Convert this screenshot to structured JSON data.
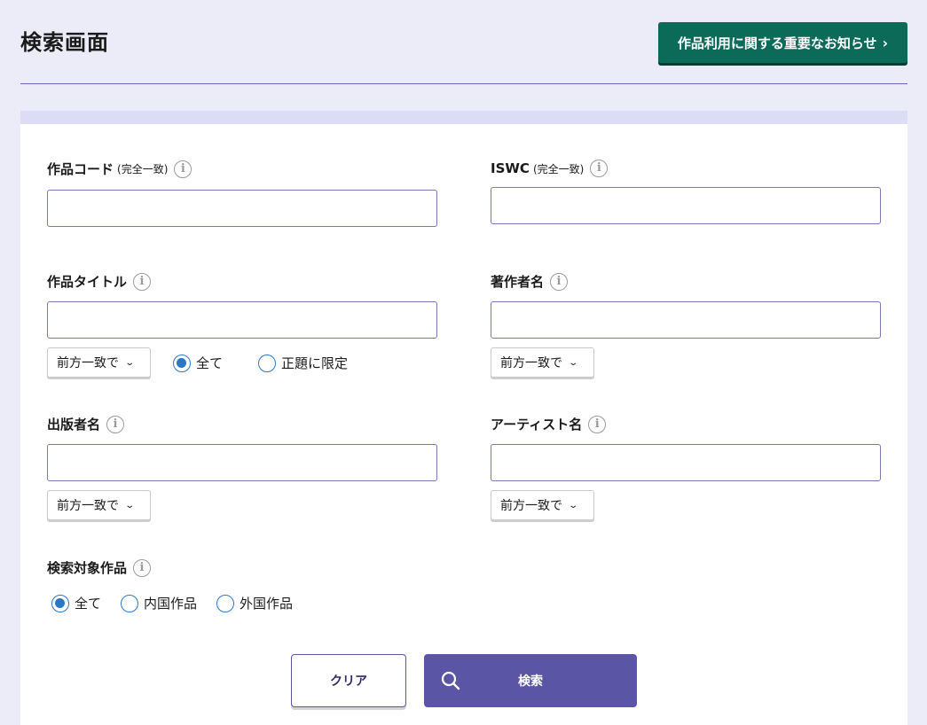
{
  "header": {
    "title": "検索画面",
    "notice_label": "作品利用に関する重要なお知らせ",
    "notice_chevron": "›"
  },
  "fields": {
    "work_code": {
      "label": "作品コード",
      "note": "(完全一致)",
      "value": ""
    },
    "iswc": {
      "label": "ISWC",
      "note": "(完全一致)",
      "value": ""
    },
    "work_title": {
      "label": "作品タイトル",
      "value": "",
      "match": "前方一致で",
      "scope_options": [
        "全て",
        "正題に限定"
      ],
      "scope_selected": "全て"
    },
    "author": {
      "label": "著作者名",
      "value": "",
      "match": "前方一致で"
    },
    "publisher": {
      "label": "出版者名",
      "value": "",
      "match": "前方一致で"
    },
    "artist": {
      "label": "アーティスト名",
      "value": "",
      "match": "前方一致で"
    },
    "target": {
      "label": "検索対象作品",
      "options": [
        "全て",
        "内国作品",
        "外国作品"
      ],
      "selected": "全て"
    }
  },
  "info_icon": "i",
  "caret": "⌄",
  "buttons": {
    "clear": "クリア",
    "search": "検索"
  },
  "colors": {
    "accent": "#5b55a6",
    "notice": "#0c6b58",
    "radio": "#2b78c2"
  }
}
